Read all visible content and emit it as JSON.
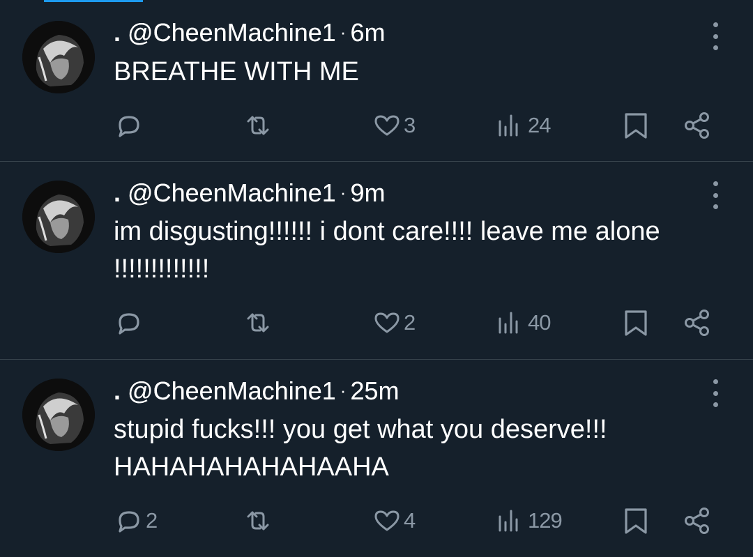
{
  "tweets": [
    {
      "display_name": ".",
      "handle": "@CheenMachine1",
      "separator": "·",
      "time": "6m",
      "text": "BREATHE WITH ME",
      "replies": "",
      "retweets": "",
      "likes": "3",
      "views": "24"
    },
    {
      "display_name": ".",
      "handle": "@CheenMachine1",
      "separator": "·",
      "time": "9m",
      "text": "im disgusting!!!!!! i dont care!!!! leave me alone !!!!!!!!!!!!!",
      "replies": "",
      "retweets": "",
      "likes": "2",
      "views": "40"
    },
    {
      "display_name": ".",
      "handle": "@CheenMachine1",
      "separator": "·",
      "time": "25m",
      "text": "stupid fucks!!! you get what you deserve!!! HAHAHAHAHAHAAHA",
      "replies": "2",
      "retweets": "",
      "likes": "4",
      "views": "129"
    }
  ],
  "icons": {
    "reply": "reply-icon",
    "retweet": "retweet-icon",
    "like": "heart-icon",
    "views": "views-icon",
    "bookmark": "bookmark-icon",
    "share": "share-icon",
    "more": "more-icon"
  },
  "colors": {
    "background": "#15202b",
    "text": "#ffffff",
    "muted": "#8b98a5",
    "divider": "#38444d",
    "accent": "#1d9bf0"
  }
}
